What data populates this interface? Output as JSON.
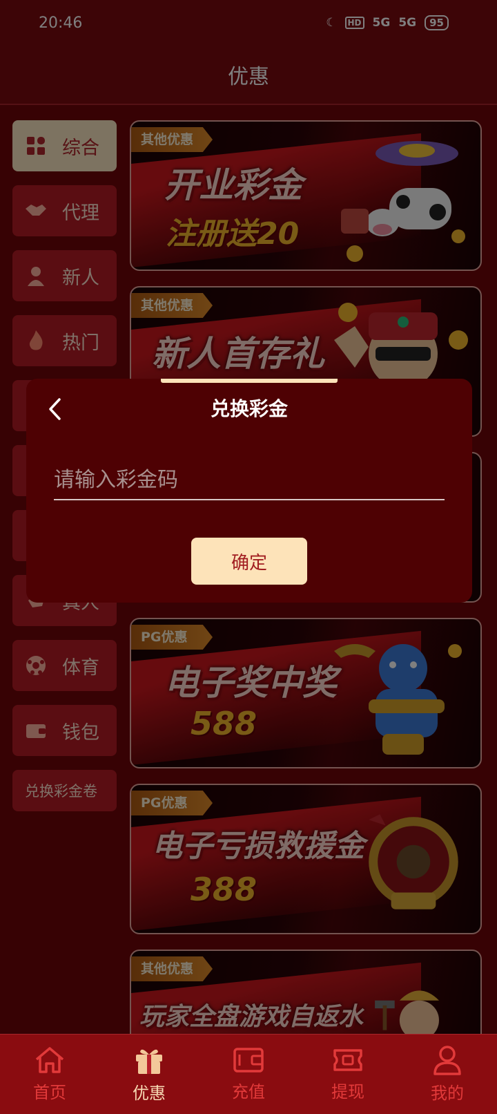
{
  "status_bar": {
    "time": "20:46",
    "signal_1": "5G",
    "signal_2": "5G",
    "battery": "95"
  },
  "header": {
    "title": "优惠"
  },
  "sidebar": {
    "items": [
      {
        "label": "综合",
        "icon": "grid-icon",
        "active": true
      },
      {
        "label": "代理",
        "icon": "handshake-icon",
        "active": false
      },
      {
        "label": "新人",
        "icon": "person-icon",
        "active": false
      },
      {
        "label": "热门",
        "icon": "flame-icon",
        "active": false
      },
      {
        "label": "",
        "icon": "cards-icon",
        "active": false
      },
      {
        "label": "",
        "icon": "shield-icon",
        "active": false
      },
      {
        "label": "",
        "icon": "star-icon",
        "active": false
      },
      {
        "label": "真人",
        "icon": "hand-icon",
        "active": false
      },
      {
        "label": "体育",
        "icon": "ball-icon",
        "active": false
      },
      {
        "label": "钱包",
        "icon": "wallet-icon",
        "active": false
      }
    ],
    "redeem_label": "兑换彩金卷"
  },
  "banners": [
    {
      "tag": "其他优惠",
      "title": "开业彩金",
      "subtitle": "注册送20",
      "art": "cow-ufo"
    },
    {
      "tag": "其他优惠",
      "title": "新人首存礼",
      "subtitle": "",
      "art": "fortune-god"
    },
    {
      "tag": "",
      "title": "",
      "subtitle": "",
      "art": ""
    },
    {
      "tag": "PG优惠",
      "title": "电子奖中奖",
      "amount": "588",
      "art": "genie"
    },
    {
      "tag": "PG优惠",
      "title": "电子亏损救援金",
      "amount": "388",
      "art": "pirate-wheel"
    },
    {
      "tag": "其他优惠",
      "title": "玩家全盘游戏自返水",
      "subtitle": "",
      "art": "miner"
    }
  ],
  "dialog": {
    "title": "兑换彩金",
    "input_placeholder": "请输入彩金码",
    "confirm_label": "确定"
  },
  "tabbar": {
    "items": [
      {
        "label": "首页",
        "icon": "home-icon",
        "active": false
      },
      {
        "label": "优惠",
        "icon": "gift-icon",
        "active": true
      },
      {
        "label": "充值",
        "icon": "wallet-icon",
        "active": false
      },
      {
        "label": "提现",
        "icon": "ticket-icon",
        "active": false
      },
      {
        "label": "我的",
        "icon": "user-icon",
        "active": false
      }
    ]
  },
  "colors": {
    "accent": "#fde3b9",
    "primary_red": "#b51a24",
    "dialog_bg": "#4e0103",
    "tab_inactive": "#e23a3a"
  }
}
